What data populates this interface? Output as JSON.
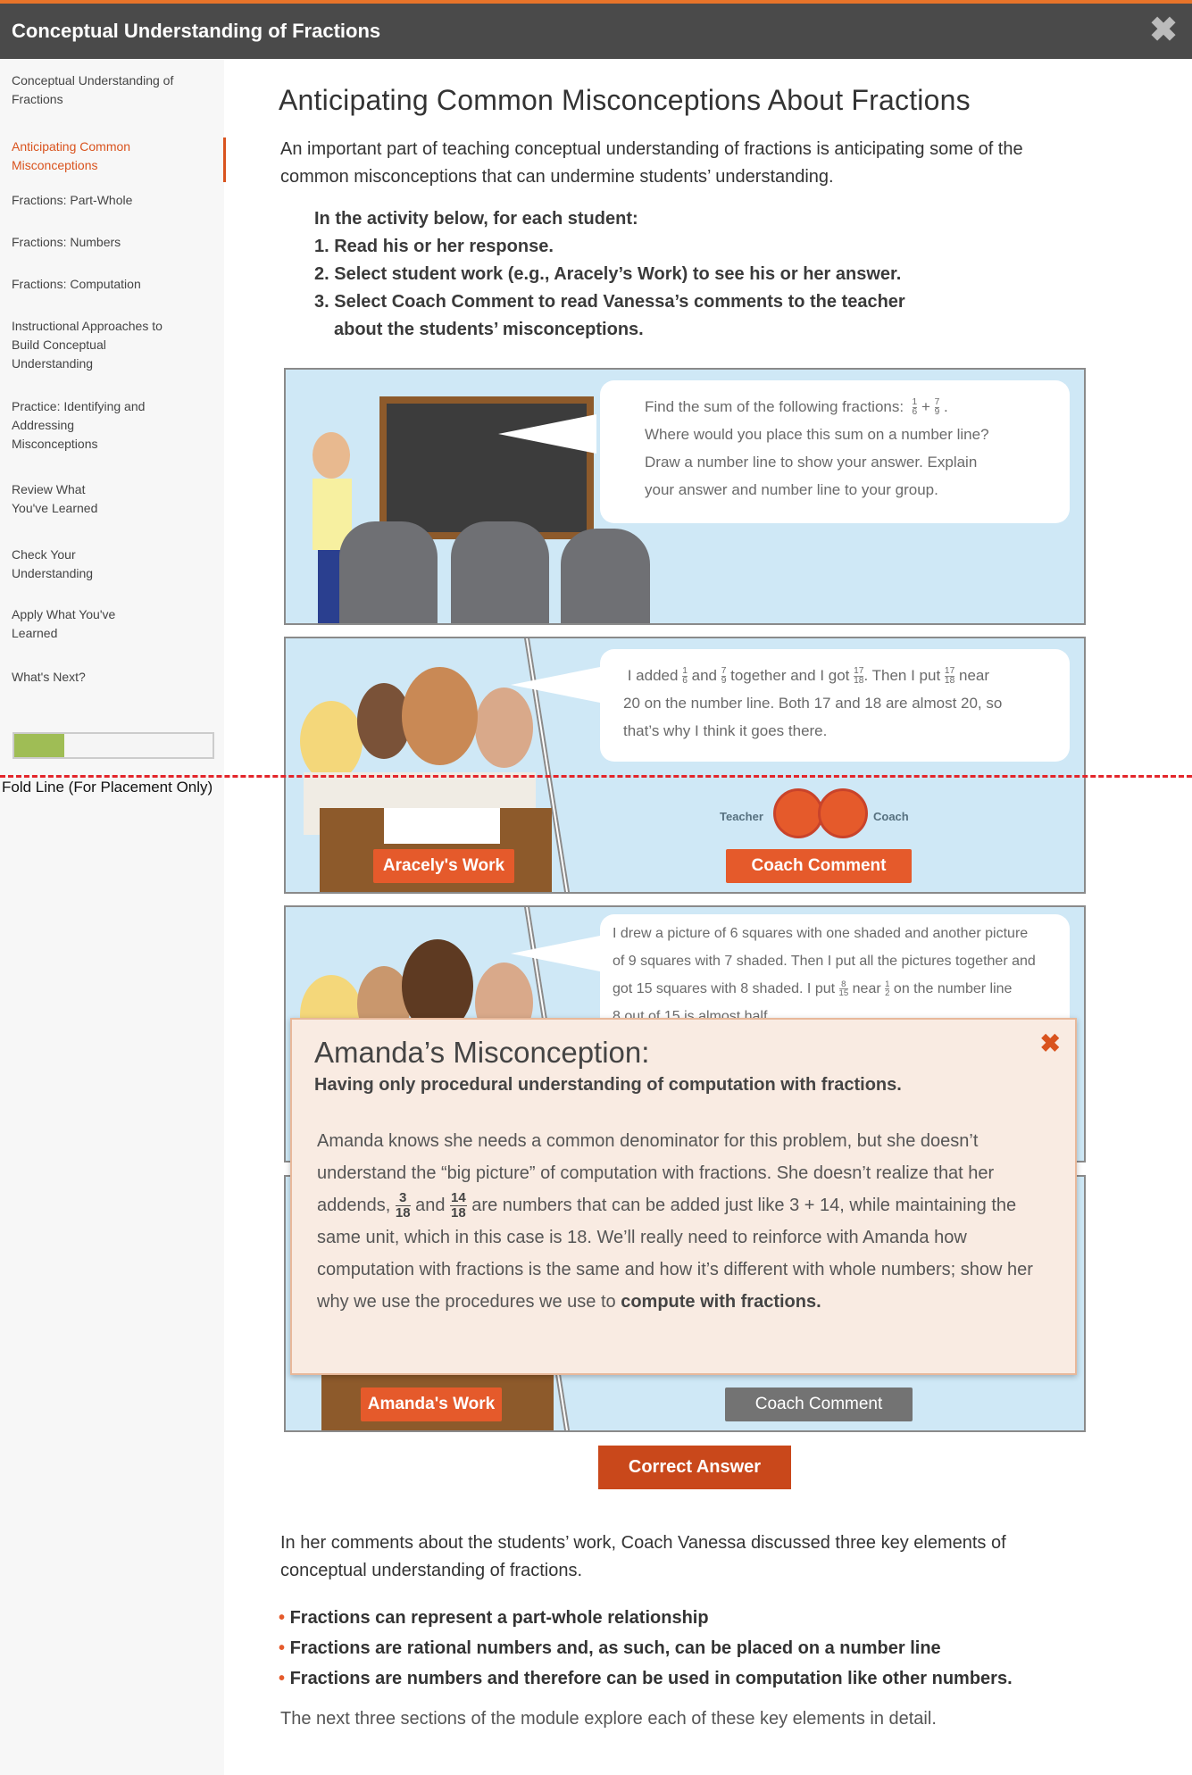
{
  "header": {
    "title": "Conceptual Understanding of Fractions",
    "close_icon": "close-x-icon"
  },
  "sidebar": {
    "items": [
      {
        "label": "Conceptual Understanding of Fractions"
      },
      {
        "label": "Anticipating Common Misconceptions",
        "active": true
      },
      {
        "label": "Fractions: Part-Whole"
      },
      {
        "label": "Fractions: Numbers"
      },
      {
        "label": "Fractions: Computation"
      },
      {
        "label": "Instructional Approaches to Build Conceptual Understanding"
      },
      {
        "label": "Practice: Identifying and Addressing Misconceptions"
      },
      {
        "label": "Review What You've Learned"
      },
      {
        "label": "Check Your Understanding"
      },
      {
        "label": "Apply What You've Learned"
      },
      {
        "label": "What's Next?"
      }
    ],
    "progress_percent": 25
  },
  "fold_label": "Fold Line (For Placement Only)",
  "main": {
    "title": "Anticipating Common Misconceptions About Fractions",
    "intro": "An important part of teaching conceptual understanding of fractions is anticipating some of the common misconceptions that can undermine students’ understanding.",
    "instructions": {
      "lead": "In the activity below, for each student:",
      "steps": [
        "1. Read his or her response.",
        "2. Select student work (e.g., Aracely’s Work) to see his or her answer.",
        "3. Select Coach Comment to read Vanessa’s comments to the teacher",
        "about the students’ misconceptions."
      ]
    },
    "task": {
      "text1": "Find the sum of the following fractions:",
      "plus": "+",
      "line2": "Where would you place this sum on a number line?",
      "line3": "Draw a number line to show your answer. Explain",
      "line4": "your answer and number line to your group."
    },
    "aracely": {
      "t1": "I added",
      "t2": "and",
      "t3": "together and I got",
      "t4": ". Then I put",
      "t5": "near",
      "line2": "20 on the number line. Both 17 and 18 are almost 20, so",
      "line3": "that’s why I think it goes there.",
      "work_button": "Aracely's Work",
      "teacher_label": "Teacher",
      "coach_label": "Coach",
      "coach_button": "Coach Comment"
    },
    "student3": {
      "line1": "I drew a picture of 6 squares with one shaded and another picture",
      "line2": "of 9 squares with 7 shaded.  Then I put all the pictures together and",
      "t1": "got 15 squares with 8 shaded.  I put",
      "t2": "near",
      "t3": "on the number line",
      "line4": "8 out of 15 is almost half"
    },
    "amanda": {
      "work_button": "Amanda's Work",
      "coach_button": "Coach Comment"
    },
    "fractions": {
      "one": "1",
      "six": "6",
      "seven": "7",
      "nine": "9",
      "seventeen": "17",
      "eighteen": "18",
      "eight": "8",
      "fifteen": "15",
      "two": "2",
      "three": "3",
      "fourteen": "14"
    },
    "popup": {
      "title": "Amanda’s Misconception:",
      "subtitle": "Having only procedural understanding of computation with fractions.",
      "p1": "Amanda knows she needs a common denominator for this problem, but she doesn’t understand the “big picture” of computation with fractions. She doesn’t realize that her addends,",
      "and": "and",
      "p2": "are numbers that can be added just like 3 + 14, while maintaining the same unit, which in this case is 18. We’ll really need to reinforce with Amanda how computation with fractions is the same and how it’s different with whole numbers; show her why we use the procedures we use to",
      "p3": "compute with fractions."
    },
    "correct_button": "Correct Answer",
    "summary": "In her comments about the students’ work, Coach Vanessa discussed three key elements of conceptual understanding of fractions.",
    "bullets": [
      "Fractions can represent a part-whole relationship",
      "Fractions are rational numbers and, as such, can be placed on a number line",
      "Fractions are numbers and therefore can be used in computation like other numbers."
    ],
    "final": "The next three sections of the module explore each of these key elements in detail."
  },
  "colors": {
    "accent": "#e55a2b",
    "header": "#4a4a4a",
    "panel": "#cfe8f6",
    "progress": "#9fbd55"
  }
}
